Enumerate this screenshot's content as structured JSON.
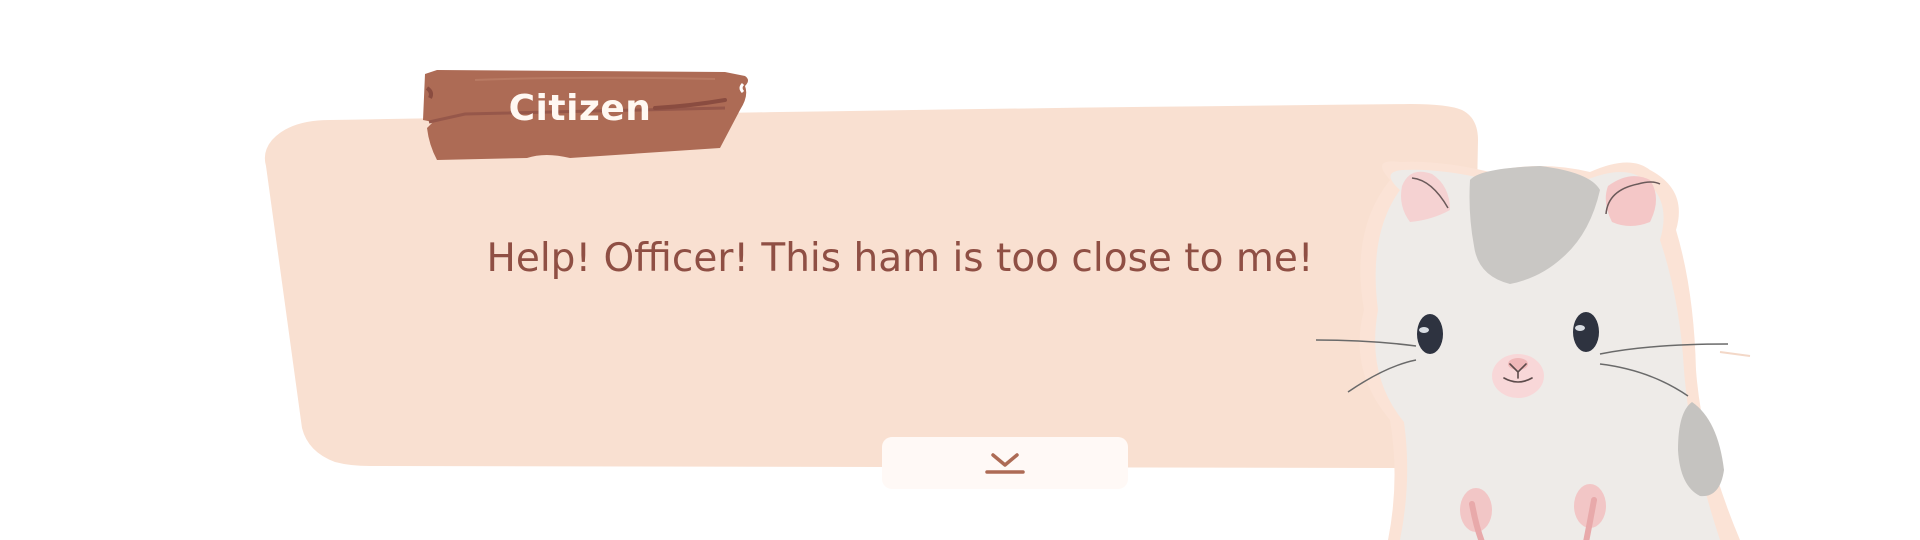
{
  "dialog": {
    "speaker_name": "Citizen",
    "text": "Help! Officer! This ham is too close to me!"
  },
  "controls": {
    "advance_icon": "chevron-down-bar-icon"
  },
  "character": {
    "portrait": "hamster-portrait"
  },
  "colors": {
    "dialog_panel": "#f9e0d1",
    "name_plank": "#ad6b55",
    "dialog_text": "#8f4f44",
    "button_bg": "#fff9f6"
  }
}
